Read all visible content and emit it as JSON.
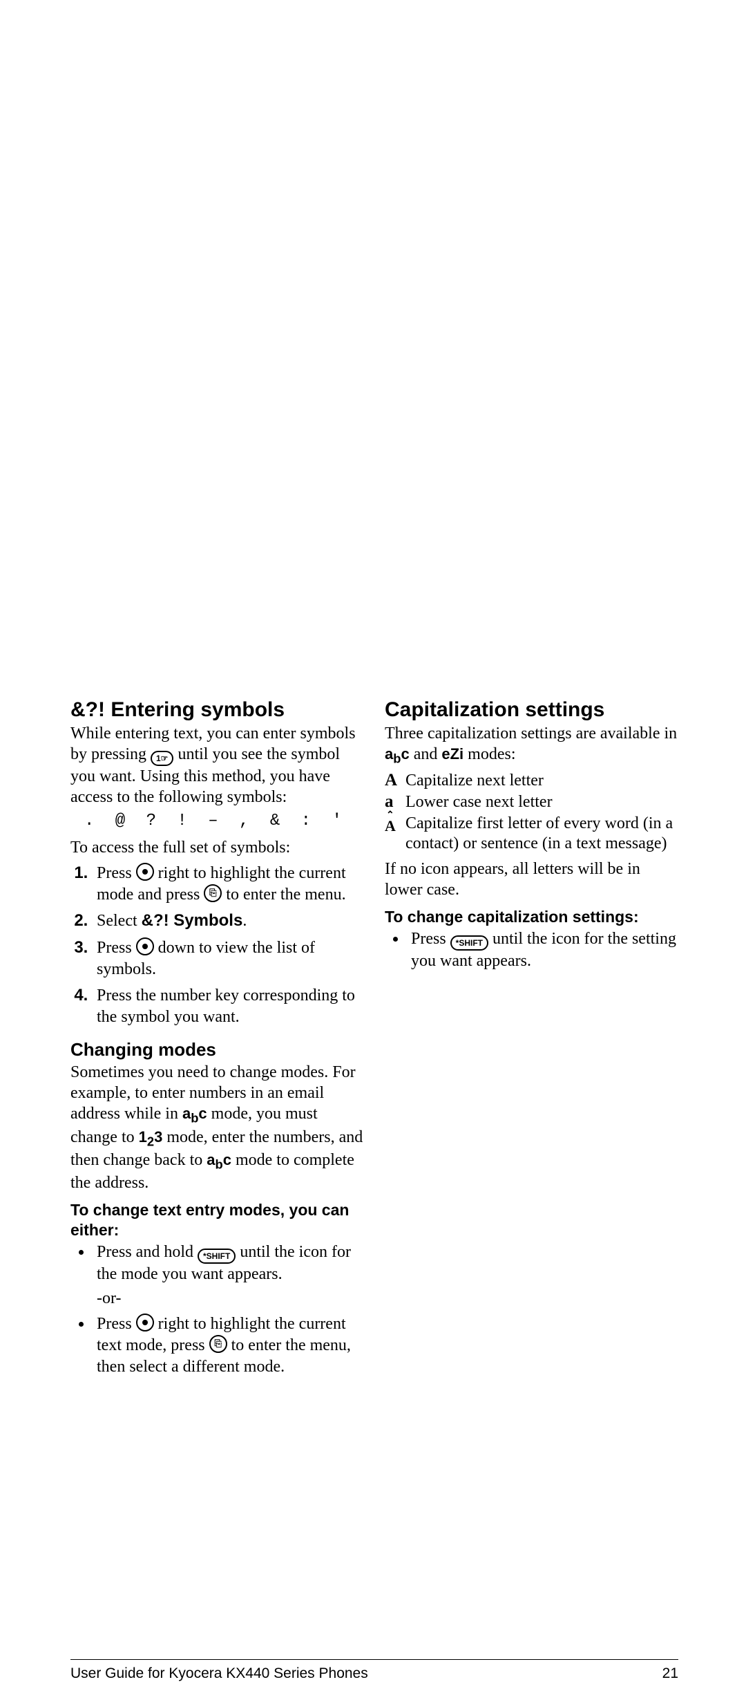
{
  "left": {
    "h1_prefix": "&?!",
    "h1": "Entering symbols",
    "p1a": "While entering text, you can enter symbols by pressing ",
    "p1b": " until you see the symbol you want. Using this method, you have access to the following symbols:",
    "symbol_row": ". @ ? ! – , & : '",
    "p2": "To access the full set of symbols:",
    "ol": [
      {
        "a": "Press ",
        "b": " right to highlight the current mode and press ",
        "c": " to enter the menu."
      },
      {
        "a": "Select ",
        "bold": "&?! Symbols",
        "c": "."
      },
      {
        "a": "Press ",
        "b": " down to view the list of symbols."
      },
      {
        "a": "Press the number key corresponding to the symbol you want."
      }
    ],
    "h2": "Changing modes",
    "p3a": "Sometimes you need to change modes. For example, to enter numbers in an email address while in ",
    "mode_abc": "abc",
    "p3b": " mode, you must change to ",
    "mode_123": "123",
    "p3c": " mode, enter the numbers, and then change back to ",
    "p3d": " mode to complete the address.",
    "subhead": "To change text entry modes, you can either:",
    "ul": [
      {
        "a": "Press and hold ",
        "b": " until the icon for the mode you want appears.",
        "or": "-or-"
      },
      {
        "a": "Press ",
        "b": " right to highlight the current text mode, press ",
        "c": " to enter the menu, then select a different mode."
      }
    ]
  },
  "right": {
    "h1": "Capitalization settings",
    "p1a": "Three capitalization settings are available in ",
    "mode_abc": "abc",
    "p1b": " and ",
    "mode_ezi": "eZi",
    "p1c": " modes:",
    "rows": [
      {
        "icon": "A",
        "text": "Capitalize next letter"
      },
      {
        "icon": "a",
        "text": "Lower case next letter"
      },
      {
        "icon": "shift",
        "text": "Capitalize first letter of every word (in a contact) or sentence (in a text message)"
      }
    ],
    "p2": "If no icon appears, all letters will be in lower case.",
    "subhead": "To change capitalization settings:",
    "ul": [
      {
        "a": "Press ",
        "b": " until the icon for the setting you want appears."
      }
    ]
  },
  "footer": {
    "left": "User Guide for Kyocera KX440 Series Phones",
    "right": "21"
  },
  "icons": {
    "key1": "1",
    "shift": "*SHIFT"
  }
}
